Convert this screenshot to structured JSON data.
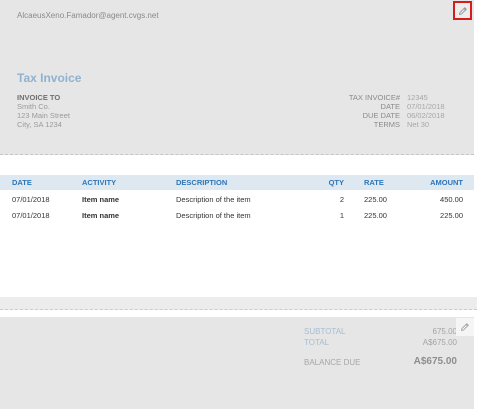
{
  "header": {
    "email": "AlcaeusXeno.Famador@agent.cvgs.net",
    "title": "Tax Invoice",
    "bill_to": {
      "heading": "INVOICE TO",
      "name": "Smith Co.",
      "street": "123 Main Street",
      "city": "City, SA 1234"
    },
    "meta": [
      {
        "label": "TAX INVOICE#",
        "value": "12345"
      },
      {
        "label": "DATE",
        "value": "07/01/2018"
      },
      {
        "label": "DUE DATE",
        "value": "06/02/2018"
      },
      {
        "label": "TERMS",
        "value": "Net 30"
      }
    ],
    "edit_icon": "pencil-icon"
  },
  "table": {
    "columns": [
      "DATE",
      "ACTIVITY",
      "DESCRIPTION",
      "QTY",
      "RATE",
      "AMOUNT"
    ],
    "rows": [
      {
        "date": "07/01/2018",
        "activity": "Item name",
        "description": "Description of the item",
        "qty": "2",
        "rate": "225.00",
        "amount": "450.00"
      },
      {
        "date": "07/01/2018",
        "activity": "Item name",
        "description": "Description of the item",
        "qty": "1",
        "rate": "225.00",
        "amount": "225.00"
      }
    ]
  },
  "totals": {
    "subtotal_label": "SUBTOTAL",
    "subtotal_value": "675.00",
    "total_label": "TOTAL",
    "total_value": "A$675.00",
    "balance_label": "BALANCE DUE",
    "balance_value": "A$675.00"
  },
  "colors": {
    "accent_blue": "#2f76b7",
    "title_blue": "#8fb2cf",
    "highlight_red": "#d81c1c"
  }
}
